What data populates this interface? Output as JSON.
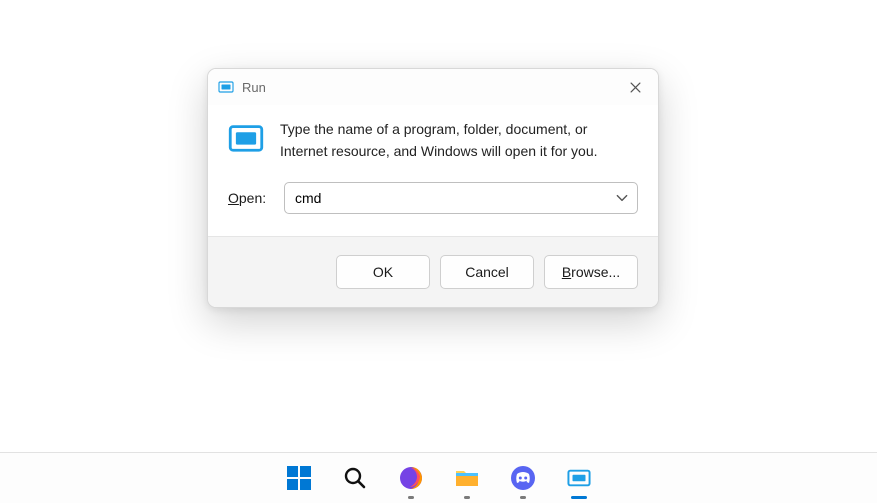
{
  "dialog": {
    "title": "Run",
    "description": "Type the name of a program, folder, document, or Internet resource, and Windows will open it for you.",
    "open_label_prefix": "O",
    "open_label_rest": "pen:",
    "input_value": "cmd",
    "buttons": {
      "ok": "OK",
      "cancel": "Cancel",
      "browse_prefix": "B",
      "browse_rest": "rowse..."
    }
  },
  "taskbar": {
    "items": [
      {
        "name": "start",
        "indicator": "none"
      },
      {
        "name": "search",
        "indicator": "none"
      },
      {
        "name": "firefox",
        "indicator": "dot"
      },
      {
        "name": "explorer",
        "indicator": "dot"
      },
      {
        "name": "discord",
        "indicator": "dot"
      },
      {
        "name": "run",
        "indicator": "active"
      }
    ]
  }
}
